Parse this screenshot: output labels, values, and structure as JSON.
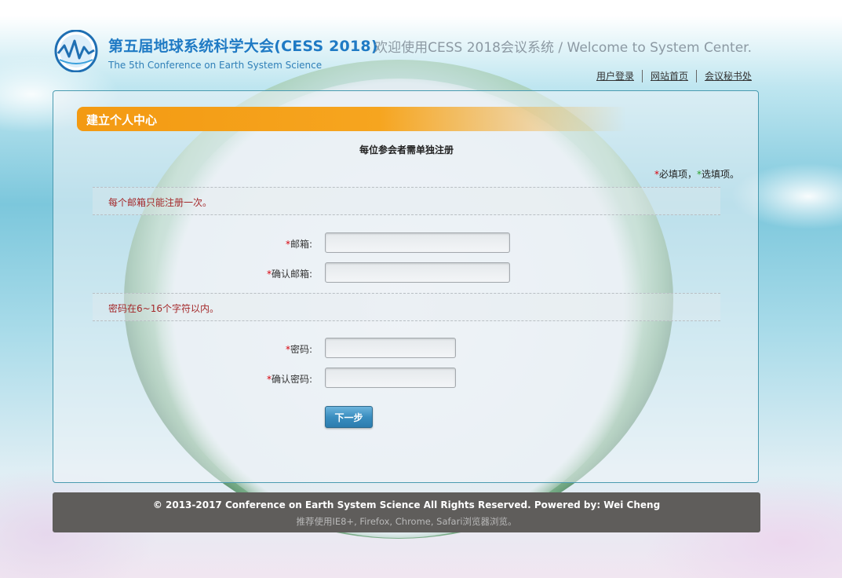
{
  "header": {
    "title_cn": "第五届地球系统科学大会(CESS 2018)",
    "title_en": "The 5th Conference on Earth System Science",
    "welcome": "欢迎使用CESS 2018会议系统 / Welcome to System Center.",
    "links": [
      "用户登录",
      "网站首页",
      "会议秘书处"
    ]
  },
  "panel": {
    "section_title": "建立个人中心",
    "notice": "每位参会者需单独注册",
    "legend": {
      "required_mark": "*",
      "required_label": "必填项，",
      "optional_mark": "*",
      "optional_label": "选填项。"
    },
    "email_hint": "每个邮箱只能注册一次。",
    "password_hint": "密码在6~16个字符以内。",
    "fields": {
      "email": {
        "mark": "*",
        "label": "邮箱:",
        "value": ""
      },
      "email_confirm": {
        "mark": "*",
        "label": "确认邮箱:",
        "value": ""
      },
      "password": {
        "mark": "*",
        "label": "密码:",
        "value": ""
      },
      "password_confirm": {
        "mark": "*",
        "label": "确认密码:",
        "value": ""
      }
    },
    "next_button": "下一步"
  },
  "footer": {
    "copyright": "© 2013-2017 Conference on Earth System Science All Rights Reserved.    Powered by: Wei Cheng",
    "browsers": "推荐使用IE8+, Firefox, Chrome, Safari浏览器浏览。"
  },
  "colors": {
    "brand_blue": "#1f7ac4",
    "accent_orange": "#f39a12",
    "required_red": "#d9000b",
    "optional_green": "#2aa12a",
    "hint_red": "#a4282a",
    "button_blue": "#3a8ec0",
    "footer_gray": "#5f5d5b"
  }
}
